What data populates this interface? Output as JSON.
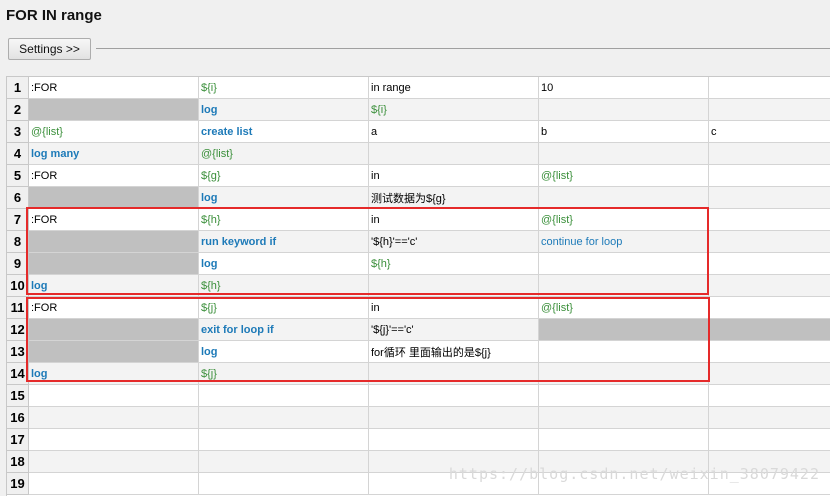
{
  "header": {
    "title": "FOR IN range",
    "settings_label": "Settings >>"
  },
  "table": {
    "rows": [
      {
        "n": "1",
        "cells": [
          ":FOR",
          "${i}",
          "in range",
          "10",
          ""
        ],
        "styles": [
          "",
          "var",
          "",
          "",
          ""
        ],
        "grey": []
      },
      {
        "n": "2",
        "cells": [
          "",
          "log",
          "${i}",
          "",
          ""
        ],
        "styles": [
          "",
          "kw",
          "var",
          "",
          ""
        ],
        "grey": [
          0
        ]
      },
      {
        "n": "3",
        "cells": [
          "@{list}",
          "create list",
          "a",
          "b",
          "c"
        ],
        "styles": [
          "var",
          "kw",
          "",
          "",
          ""
        ],
        "grey": []
      },
      {
        "n": "4",
        "cells": [
          "log many",
          "@{list}",
          "",
          "",
          ""
        ],
        "styles": [
          "kw",
          "var",
          "",
          "",
          ""
        ],
        "grey": []
      },
      {
        "n": "5",
        "cells": [
          ":FOR",
          "${g}",
          "in",
          "@{list}",
          ""
        ],
        "styles": [
          "",
          "var",
          "",
          "var",
          ""
        ],
        "grey": []
      },
      {
        "n": "6",
        "cells": [
          "",
          "log",
          "测试数据为${g}",
          "",
          ""
        ],
        "styles": [
          "",
          "kw",
          "",
          "",
          ""
        ],
        "grey": [
          0
        ]
      },
      {
        "n": "7",
        "cells": [
          ":FOR",
          "${h}",
          "in",
          "@{list}",
          ""
        ],
        "styles": [
          "",
          "var",
          "",
          "var",
          ""
        ],
        "grey": []
      },
      {
        "n": "8",
        "cells": [
          "",
          "run keyword if",
          "'${h}'=='c'",
          "continue for loop",
          ""
        ],
        "styles": [
          "",
          "kw",
          "",
          "kwplain",
          ""
        ],
        "grey": [
          0
        ]
      },
      {
        "n": "9",
        "cells": [
          "",
          "log",
          "${h}",
          "",
          ""
        ],
        "styles": [
          "",
          "kw",
          "var",
          "",
          ""
        ],
        "grey": [
          0
        ]
      },
      {
        "n": "10",
        "cells": [
          "log",
          "${h}",
          "",
          "",
          ""
        ],
        "styles": [
          "kw",
          "var",
          "",
          "",
          ""
        ],
        "grey": []
      },
      {
        "n": "11",
        "cells": [
          ":FOR",
          "${j}",
          "in",
          "@{list}",
          ""
        ],
        "styles": [
          "",
          "var",
          "",
          "var",
          ""
        ],
        "grey": []
      },
      {
        "n": "12",
        "cells": [
          "",
          "exit for loop if",
          "'${j}'=='c'",
          "",
          ""
        ],
        "styles": [
          "",
          "kw",
          "",
          "",
          ""
        ],
        "grey": [
          0,
          3,
          4
        ]
      },
      {
        "n": "13",
        "cells": [
          "",
          "log",
          "for循环 里面输出的是${j}",
          "",
          ""
        ],
        "styles": [
          "",
          "kw",
          "",
          "",
          ""
        ],
        "grey": [
          0
        ]
      },
      {
        "n": "14",
        "cells": [
          "log",
          "${j}",
          "",
          "",
          ""
        ],
        "styles": [
          "kw",
          "var",
          "",
          "",
          ""
        ],
        "grey": []
      },
      {
        "n": "15",
        "cells": [
          "",
          "",
          "",
          "",
          ""
        ],
        "styles": [
          "",
          "",
          "",
          "",
          ""
        ],
        "grey": []
      },
      {
        "n": "16",
        "cells": [
          "",
          "",
          "",
          "",
          ""
        ],
        "styles": [
          "",
          "",
          "",
          "",
          ""
        ],
        "grey": []
      },
      {
        "n": "17",
        "cells": [
          "",
          "",
          "",
          "",
          ""
        ],
        "styles": [
          "",
          "",
          "",
          "",
          ""
        ],
        "grey": []
      },
      {
        "n": "18",
        "cells": [
          "",
          "",
          "",
          "",
          ""
        ],
        "styles": [
          "",
          "",
          "",
          "",
          ""
        ],
        "grey": []
      },
      {
        "n": "19",
        "cells": [
          "",
          "",
          "",
          "",
          ""
        ],
        "styles": [
          "",
          "",
          "",
          "",
          ""
        ],
        "grey": []
      }
    ]
  },
  "watermark": "https://blog.csdn.net/weixin_38079422",
  "colors": {
    "keyword": "#1d7ab8",
    "variable": "#3a8f3a",
    "highlight_box": "#e52a2a",
    "grey_cell": "#c0c0c0"
  }
}
